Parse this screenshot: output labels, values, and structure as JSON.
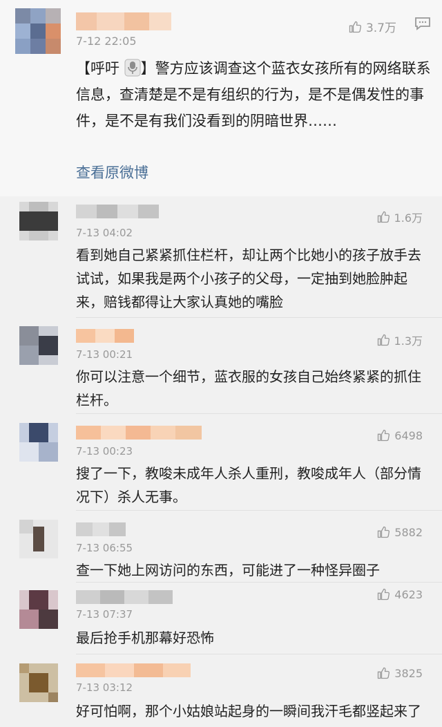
{
  "top_comment": {
    "time": "7-12 22:05",
    "likes": "3.7万",
    "text_prefix": "【呼吁",
    "text_suffix": "】警方应该调查这个蓝衣女孩所有的网络联系信息，查清楚是不是有组织的行为，是不是偶发性的事件，是不是有我们没看到的阴暗世界……",
    "view_original": "查看原微博",
    "icons": [
      "thumb-up-icon",
      "comment-icon",
      "microphone-icon"
    ]
  },
  "replies": [
    {
      "time": "7-13 04:02",
      "likes": "1.6万",
      "text": "看到她自己紧紧抓住栏杆，却让两个比她小的孩子放手去试试，如果我是两个小孩子的父母，一定抽到她脸肿起来，赔钱都得让大家认真她的嘴脸"
    },
    {
      "time": "7-13 00:21",
      "likes": "1.3万",
      "text": "你可以注意一个细节，蓝衣服的女孩自己始终紧紧的抓住栏杆。"
    },
    {
      "time": "7-13 00:23",
      "likes": "6498",
      "text": "搜了一下，教唆未成年人杀人重刑，教唆成年人（部分情况下）杀人无事。"
    },
    {
      "time": "7-13 06:55",
      "likes": "5882",
      "text": "查一下她上网访问的东西，可能进了一种怪异圈子"
    },
    {
      "time": "7-13 07:37",
      "likes": "4623",
      "text": "最后抢手机那幕好恐怖"
    },
    {
      "time": "7-13 03:12",
      "likes": "3825",
      "text": "好可怕啊，那个小姑娘站起身的一瞬间我汗毛都竖起来了"
    }
  ],
  "colors": {
    "link": "#4a6f96",
    "muted": "#999999",
    "text": "#222222",
    "top_bg": "#f7f7f7",
    "sub_bg": "#f1f1f1"
  }
}
